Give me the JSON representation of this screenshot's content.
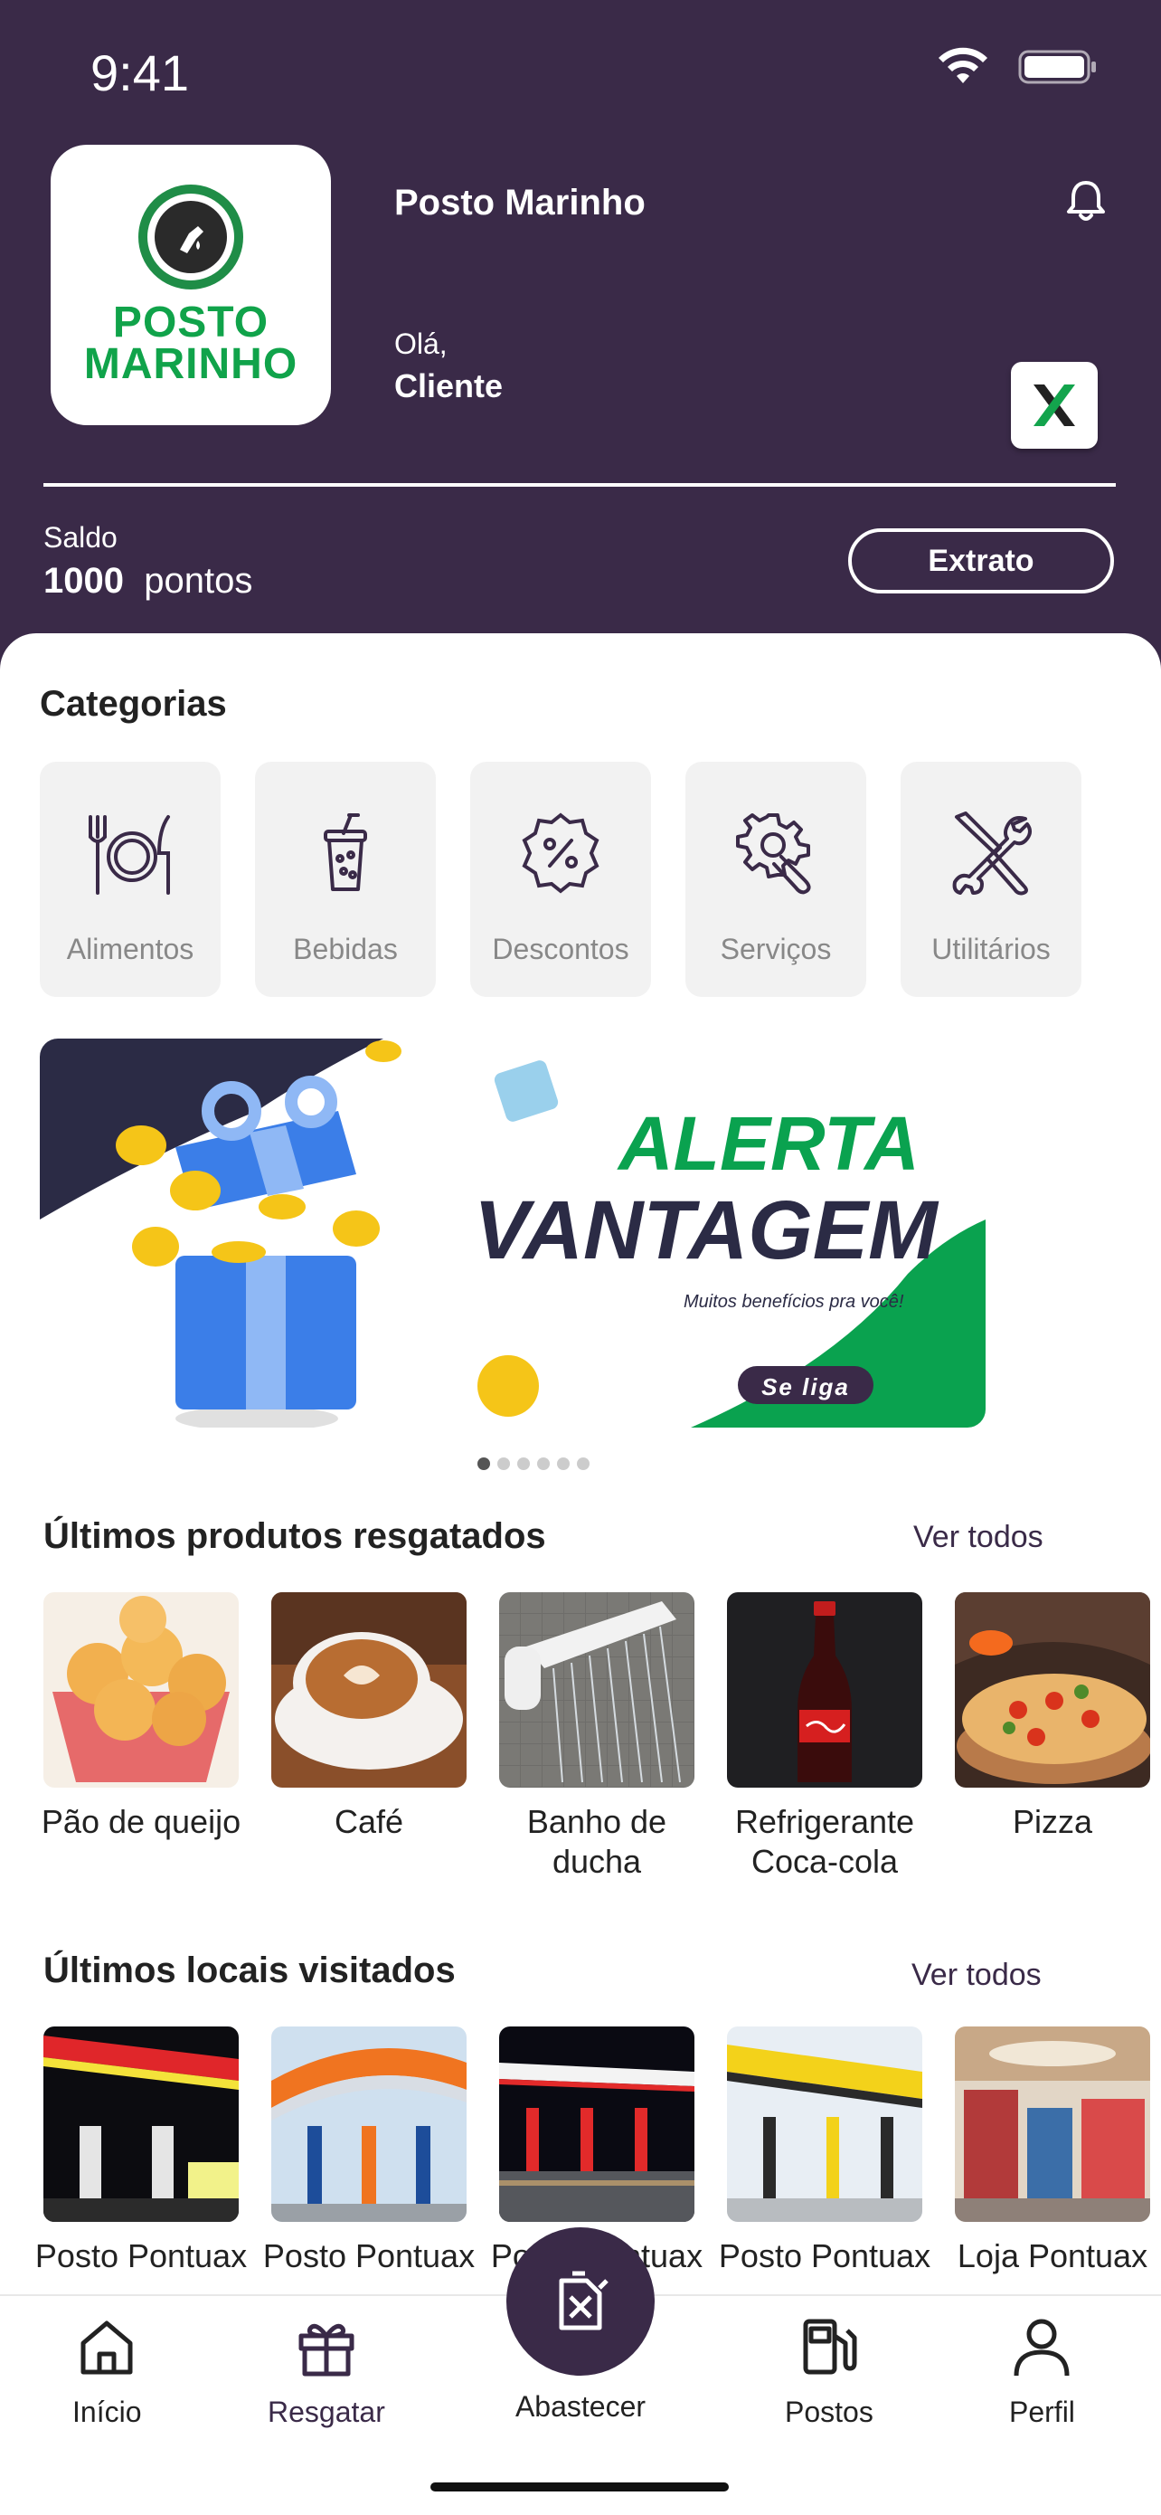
{
  "status_bar": {
    "time": "9:41"
  },
  "header": {
    "logo_line1": "POSTO",
    "logo_line2": "MARINHO",
    "app_title": "Posto Marinho",
    "greeting": "Olá,",
    "user_name": "Cliente",
    "balance_label": "Saldo",
    "balance_value": "1000",
    "balance_unit": "pontos",
    "statement_button": "Extrato"
  },
  "categories": {
    "title": "Categorias",
    "items": [
      {
        "label": "Alimentos",
        "icon": "utensils-icon"
      },
      {
        "label": "Bebidas",
        "icon": "drink-cup-icon"
      },
      {
        "label": "Descontos",
        "icon": "discount-badge-icon"
      },
      {
        "label": "Serviços",
        "icon": "gear-wrench-icon"
      },
      {
        "label": "Utilitários",
        "icon": "tools-icon"
      }
    ]
  },
  "banner": {
    "headline1": "ALERTA",
    "headline2": "VANTAGEM",
    "subtitle": "Muitos benefícios pra você!",
    "cta": "Se liga",
    "slide_count": 6,
    "active_slide": 1,
    "colors": {
      "green": "#0aa24f",
      "navy": "#2b2b45",
      "gift": "#3b7ee8",
      "coin": "#f5c518"
    }
  },
  "recent_products": {
    "title": "Últimos produtos resgatados",
    "see_all": "Ver todos",
    "items": [
      {
        "label": "Pão de queijo"
      },
      {
        "label": "Café"
      },
      {
        "label": "Banho de ducha"
      },
      {
        "label": "Refrigerante Coca-cola"
      },
      {
        "label": "Pizza"
      }
    ]
  },
  "recent_places": {
    "title": "Últimos locais visitados",
    "see_all": "Ver todos",
    "items": [
      {
        "label": "Posto Pontuax"
      },
      {
        "label": "Posto Pontuax"
      },
      {
        "label": "Posto Pontuax"
      },
      {
        "label": "Posto Pontuax"
      },
      {
        "label": "Loja Pontuax"
      }
    ]
  },
  "bottom_nav": {
    "items": [
      {
        "label": "Início",
        "icon": "home-icon"
      },
      {
        "label": "Resgatar",
        "icon": "gift-icon"
      },
      {
        "label": "Abastecer",
        "icon": "fuel-can-icon"
      },
      {
        "label": "Postos",
        "icon": "fuel-pump-icon"
      },
      {
        "label": "Perfil",
        "icon": "user-icon"
      }
    ]
  },
  "colors": {
    "primary": "#3a2a48",
    "accent_green": "#10a34a"
  }
}
